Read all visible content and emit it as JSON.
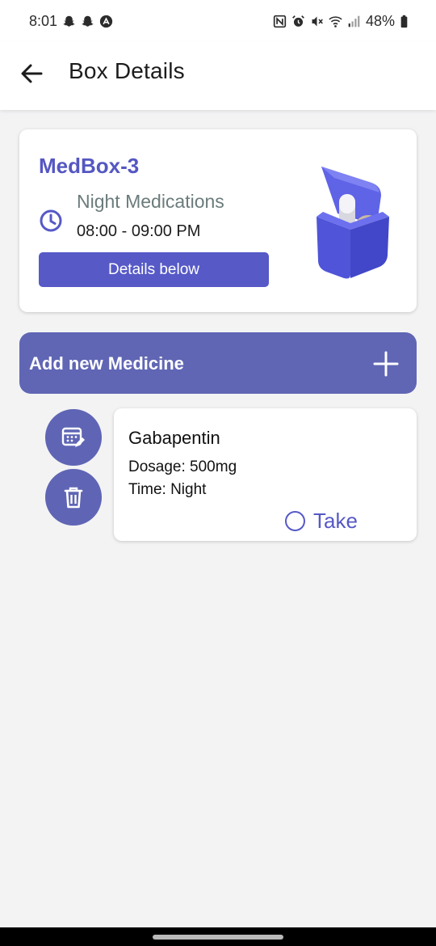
{
  "status_bar": {
    "time": "8:01",
    "battery": "48%",
    "left_icons": [
      "snapchat-icon",
      "snapchat-icon",
      "app-notification-icon"
    ],
    "right_icons": [
      "nfc-icon",
      "alarm-icon",
      "mute-icon",
      "wifi-icon",
      "signal-icon",
      "battery-icon"
    ]
  },
  "app_bar": {
    "title": "Box Details",
    "back_icon": "arrow-left-icon"
  },
  "box_card": {
    "name": "MedBox-3",
    "schedule_name": "Night Medications",
    "schedule_time": "08:00 - 09:00 PM",
    "details_button": "Details below",
    "clock_icon": "clock-icon",
    "image": "pillbox-illustration"
  },
  "add_medicine": {
    "label": "Add new Medicine",
    "icon": "plus-icon"
  },
  "medicines": [
    {
      "name": "Gabapentin",
      "dosage": "Dosage: 500mg",
      "time": "Time: Night",
      "take_label": "Take",
      "taken": false,
      "edit_icon": "calendar-edit-icon",
      "delete_icon": "trash-icon"
    }
  ],
  "colors": {
    "primary": "#5659c6",
    "accent_dark": "#5f65b4",
    "background": "#f3f3f4",
    "muted_text": "#6b7b7b"
  }
}
